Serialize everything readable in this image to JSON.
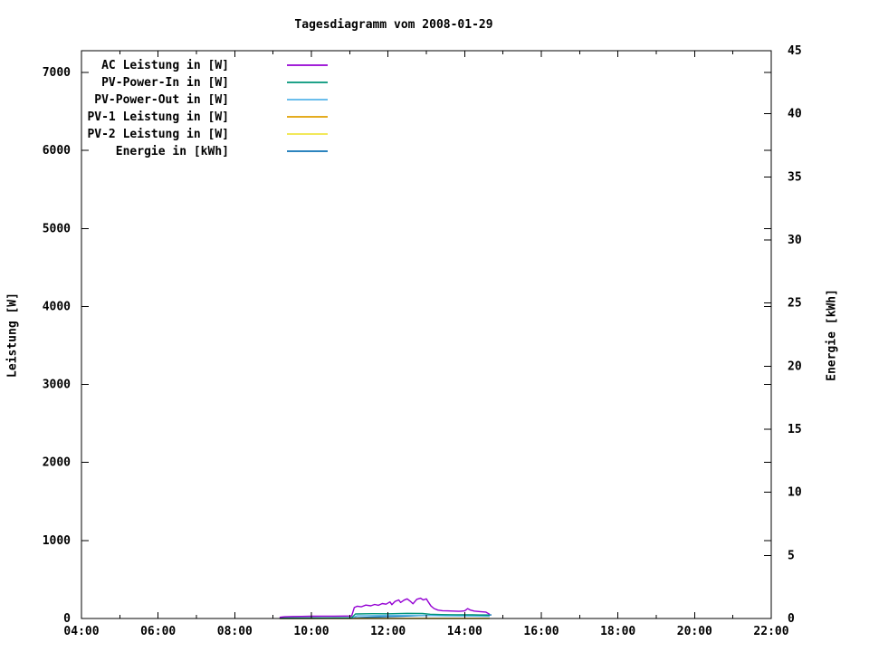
{
  "title": "Tagesdiagramm vom 2008-01-29",
  "background_color": "#ffffff",
  "axis_color": "#000000",
  "chart_data": {
    "type": "line",
    "title": "Tagesdiagramm vom 2008-01-29",
    "grid": false,
    "legend": {
      "position": "top-left-inside",
      "alignment": "right-justified-labels"
    },
    "x": {
      "label": "",
      "start_hour": 4,
      "end_hour": 22,
      "major_tick_hours": 2,
      "minor_tick_hours": 1,
      "tick_labels": [
        "04:00",
        "06:00",
        "08:00",
        "10:00",
        "12:00",
        "14:00",
        "16:00",
        "18:00",
        "20:00",
        "22:00"
      ]
    },
    "y_left": {
      "label": "Leistung [W]",
      "min": 0,
      "max": 7280,
      "tick_step": 1000,
      "ticks": [
        0,
        1000,
        2000,
        3000,
        4000,
        5000,
        6000,
        7000
      ],
      "tick_labels": [
        "0",
        "1000",
        "2000",
        "3000",
        "4000",
        "5000",
        "6000",
        "7000"
      ]
    },
    "y_right": {
      "label": "Energie [kWh]",
      "min": 0,
      "max": 45,
      "tick_step": 5,
      "ticks": [
        0,
        5,
        10,
        15,
        20,
        25,
        30,
        35,
        40,
        45
      ],
      "tick_labels": [
        "0",
        "5",
        "10",
        "15",
        "20",
        "25",
        "30",
        "35",
        "40",
        "45"
      ]
    },
    "series": [
      {
        "name": "AC Leistung in [W]",
        "color": "#9400d3",
        "axis": "left",
        "points": [
          [
            9.17,
            15
          ],
          [
            9.3,
            22
          ],
          [
            9.5,
            25
          ],
          [
            9.75,
            27
          ],
          [
            10.0,
            29
          ],
          [
            10.3,
            30
          ],
          [
            10.6,
            30
          ],
          [
            10.85,
            31
          ],
          [
            11.05,
            33
          ],
          [
            11.12,
            140
          ],
          [
            11.2,
            158
          ],
          [
            11.3,
            150
          ],
          [
            11.42,
            172
          ],
          [
            11.55,
            162
          ],
          [
            11.65,
            180
          ],
          [
            11.75,
            170
          ],
          [
            11.85,
            192
          ],
          [
            11.95,
            183
          ],
          [
            12.05,
            213
          ],
          [
            12.1,
            178
          ],
          [
            12.18,
            218
          ],
          [
            12.28,
            238
          ],
          [
            12.33,
            205
          ],
          [
            12.42,
            236
          ],
          [
            12.5,
            252
          ],
          [
            12.58,
            222
          ],
          [
            12.65,
            188
          ],
          [
            12.75,
            246
          ],
          [
            12.85,
            260
          ],
          [
            12.92,
            238
          ],
          [
            13.0,
            252
          ],
          [
            13.05,
            212
          ],
          [
            13.12,
            160
          ],
          [
            13.2,
            128
          ],
          [
            13.3,
            108
          ],
          [
            13.42,
            100
          ],
          [
            13.55,
            98
          ],
          [
            13.7,
            95
          ],
          [
            13.85,
            92
          ],
          [
            14.0,
            98
          ],
          [
            14.08,
            126
          ],
          [
            14.15,
            108
          ],
          [
            14.25,
            95
          ],
          [
            14.4,
            88
          ],
          [
            14.55,
            82
          ],
          [
            14.65,
            55
          ]
        ]
      },
      {
        "name": "PV-Power-In in [W]",
        "color": "#009478",
        "axis": "left",
        "points": [
          [
            9.17,
            6
          ],
          [
            10.5,
            8
          ],
          [
            11.05,
            10
          ],
          [
            11.15,
            58
          ],
          [
            11.6,
            62
          ],
          [
            12.0,
            60
          ],
          [
            12.5,
            66
          ],
          [
            12.9,
            64
          ],
          [
            13.1,
            55
          ],
          [
            13.4,
            50
          ],
          [
            13.8,
            48
          ],
          [
            14.2,
            46
          ],
          [
            14.65,
            40
          ]
        ]
      },
      {
        "name": "PV-Power-Out in [W]",
        "color": "#56b4e9",
        "axis": "left",
        "points": [
          [
            9.17,
            4
          ],
          [
            10.5,
            5
          ],
          [
            11.05,
            6
          ],
          [
            11.2,
            36
          ],
          [
            12.0,
            40
          ],
          [
            12.6,
            42
          ],
          [
            13.0,
            40
          ],
          [
            13.5,
            34
          ],
          [
            14.0,
            32
          ],
          [
            14.65,
            28
          ]
        ]
      },
      {
        "name": "PV-1 Leistung in [W]",
        "color": "#e0a000",
        "axis": "left",
        "points": [
          [
            9.17,
            1
          ],
          [
            14.65,
            1
          ]
        ]
      },
      {
        "name": "PV-2 Leistung in [W]",
        "color": "#f0e442",
        "axis": "left",
        "points": [
          [
            9.17,
            1
          ],
          [
            14.65,
            1
          ]
        ]
      },
      {
        "name": "Energie in [kWh]",
        "color": "#0e72b5",
        "axis": "right",
        "points": [
          [
            9.17,
            0
          ],
          [
            10.0,
            0.01
          ],
          [
            11.0,
            0.03
          ],
          [
            11.3,
            0.07
          ],
          [
            11.6,
            0.11
          ],
          [
            12.0,
            0.15
          ],
          [
            12.4,
            0.19
          ],
          [
            12.8,
            0.23
          ],
          [
            13.2,
            0.26
          ],
          [
            13.6,
            0.27
          ],
          [
            14.0,
            0.28
          ],
          [
            14.45,
            0.28
          ],
          [
            14.7,
            0.28
          ]
        ]
      }
    ]
  }
}
